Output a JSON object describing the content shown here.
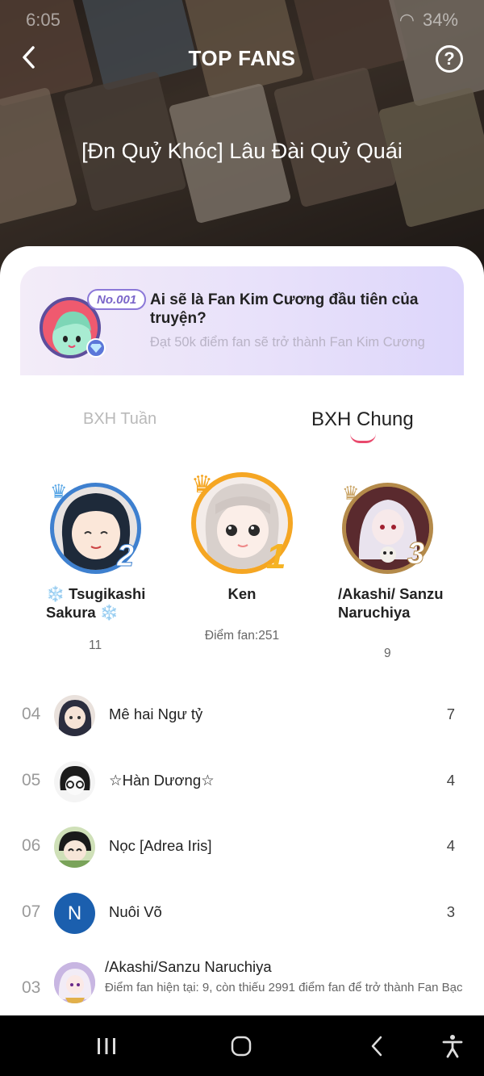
{
  "status": {
    "time": "6:05",
    "battery": "34%"
  },
  "header": {
    "title": "TOP FANS",
    "book_title": "[Đn Quỷ Khóc] Lâu Đài Quỷ Quái"
  },
  "promo": {
    "badge": "No.001",
    "title": "Ai sẽ là Fan Kim Cương đầu tiên của truyện?",
    "subtitle": "Đạt 50k điểm fan sẽ trở thành Fan Kim Cương"
  },
  "tabs": {
    "weekly": "BXH Tuần",
    "general": "BXH Chung",
    "active": "general"
  },
  "podium": [
    {
      "rank": "2",
      "name": "❄️ Tsugikashi Sakura ❄️",
      "score": "11",
      "accent": "#3e80cf"
    },
    {
      "rank": "1",
      "name": "Ken",
      "score": "Điểm fan:251",
      "accent": "#f5a623"
    },
    {
      "rank": "3",
      "name": "/Akashi/ Sanzu Naruchiya",
      "score": "9",
      "accent": "#b48a4a"
    }
  ],
  "list": [
    {
      "rank": "04",
      "name": "Mê hai Ngư tỷ",
      "score": "7"
    },
    {
      "rank": "05",
      "name": "☆Hàn Dương☆",
      "score": "4"
    },
    {
      "rank": "06",
      "name": "Nọc [Adrea Iris]",
      "score": "4"
    },
    {
      "rank": "07",
      "name": "Nuôi Võ",
      "score": "3",
      "initial": "N"
    }
  ],
  "me": {
    "rank": "03",
    "name": "/Akashi/Sanzu Naruchiya",
    "hint": "Điểm fan hiện tại: 9, còn thiếu 2991 điểm fan để trở thành Fan Bạc"
  },
  "colors": {
    "accent": "#e94a6d",
    "nav_bg": "#000000",
    "initial_avatar": "#1b5fae"
  }
}
